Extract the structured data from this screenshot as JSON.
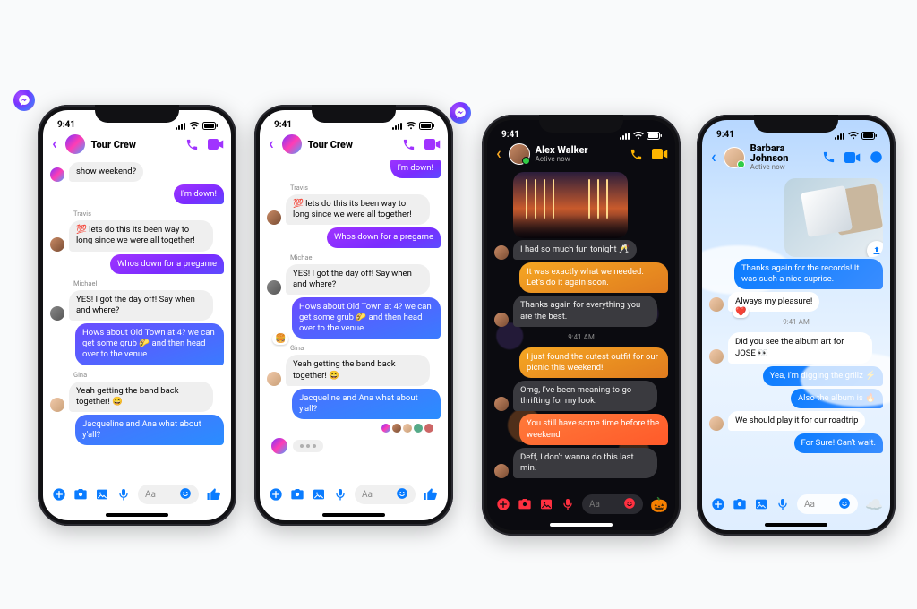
{
  "status": {
    "time": "9:41"
  },
  "composer": {
    "placeholder": "Aa"
  },
  "phone_a": {
    "title": "Tour Crew",
    "m0_partial": "show weekend?",
    "r0": "I'm down!",
    "s1": "Travis",
    "m1": "💯 lets do this its been way to long since we were all together!",
    "r1": "Whos down for a pregame",
    "s2": "Michael",
    "m2": "YES! I got the day off! Say when and where?",
    "r2": "Hows about Old Town at 4? we can get some grub 🌮 and then head over to the venue.",
    "s3": "Gina",
    "m3": "Yeah getting the band back together! 😄",
    "r3": "Jacqueline and Ana what about y'all?"
  },
  "phone_b": {
    "title": "Tour Crew",
    "r0_partial": "I'm down!",
    "s1": "Travis",
    "m1": "💯 lets do this its been way to long since we were all together!",
    "r1": "Whos down for a pregame",
    "s2": "Michael",
    "m2": "YES! I got the day off! Say when and where?",
    "r2": "Hows about Old Town at 4? we can get some grub 🌮 and then head over to the venue.",
    "s3": "Gina",
    "m3": "Yeah getting the band back together! 😄",
    "r3": "Jacqueline and Ana what about y'all?"
  },
  "phone_c": {
    "title": "Alex Walker",
    "subtitle": "Active now",
    "m1": "I had so much fun tonight 🥂",
    "r1": "It was exactly what we needed. Let's do it again soon.",
    "m2": "Thanks again for everything you are the best.",
    "time1": "9:41 AM",
    "r2": "I just found the cutest outfit for our picnic this weekend!",
    "m3": "Omg, I've been meaning to go thrifting for my look.",
    "r3": "You still have some time before the weekend",
    "m4": "Deff, I don't wanna do this last min."
  },
  "phone_d": {
    "title": "Barbara Johnson",
    "subtitle": "Active now",
    "r1": "Thanks again for the records! It was such a nice suprise.",
    "m1": "Always my pleasure!",
    "time1": "9:41 AM",
    "m2": "Did you see the album art for JOSE 👀",
    "r2": "Yea, I'm digging the grillz ⚡",
    "r3": "Also the album is 🔥",
    "m3": "We should play it for our roadtrip",
    "r4": "For Sure! Can't wait."
  }
}
